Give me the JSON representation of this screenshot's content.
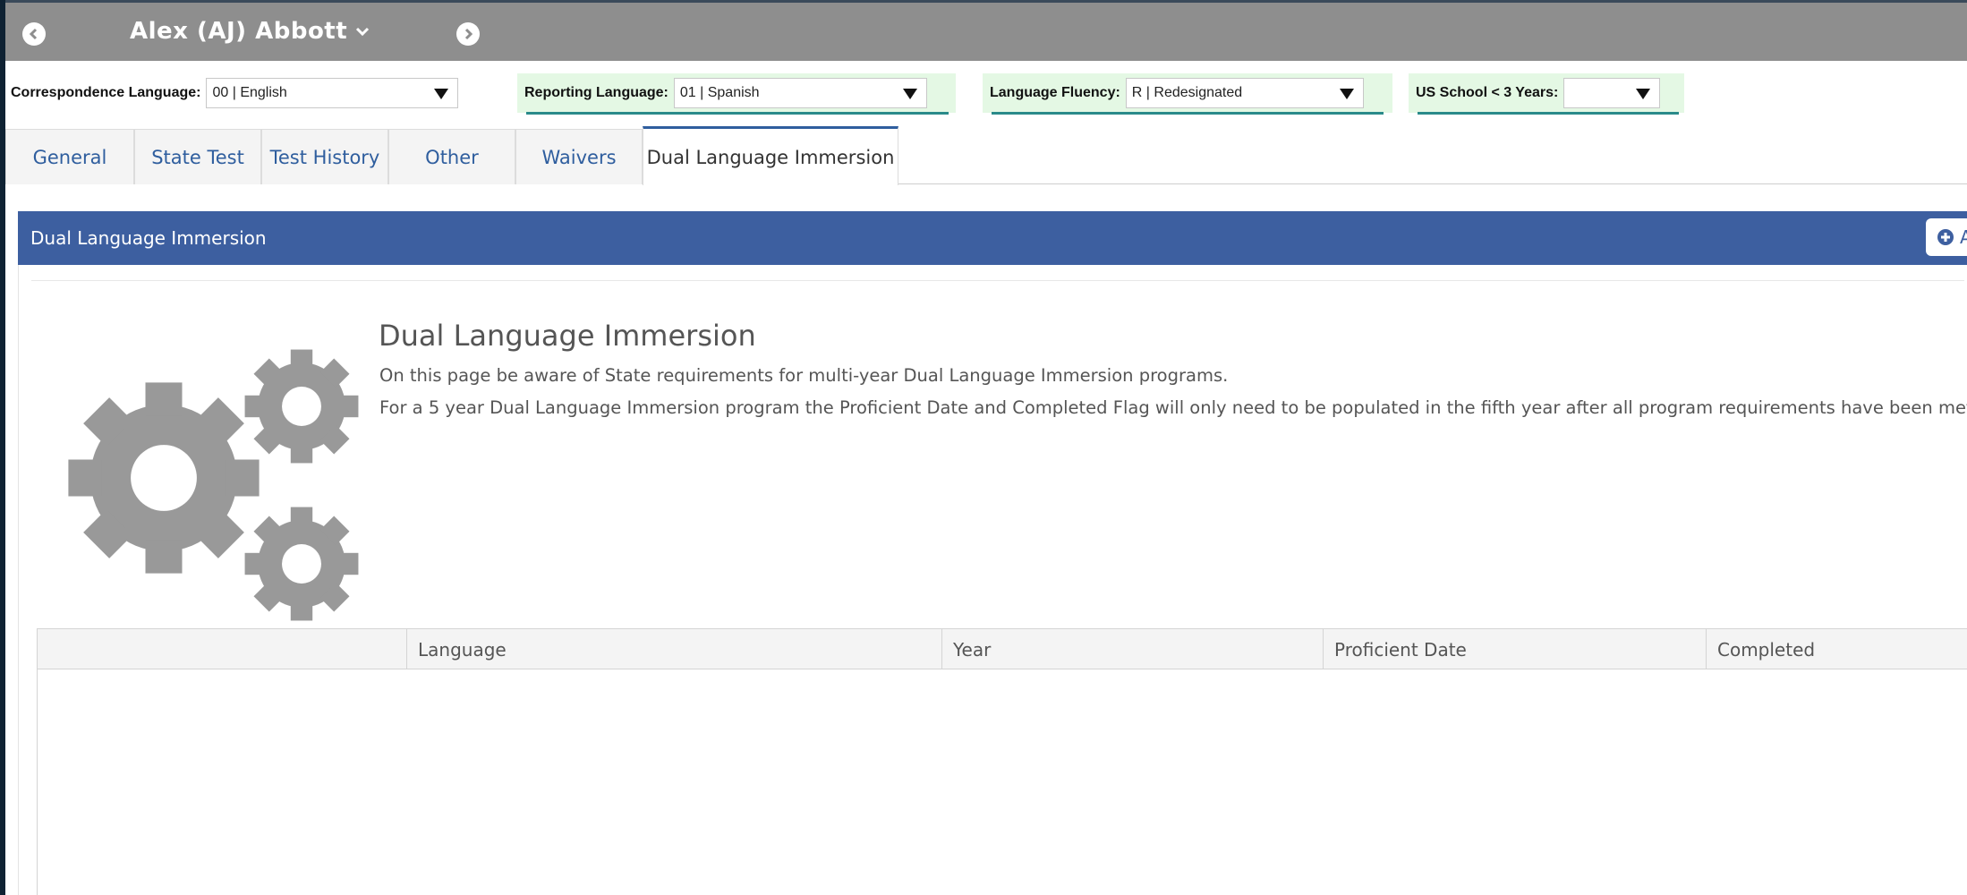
{
  "header": {
    "student_name": "Alex (AJ) Abbott",
    "prev_icon": "arrow-left-circle-icon",
    "next_icon": "arrow-right-circle-icon"
  },
  "fields": {
    "correspondence": {
      "label": "Correspondence Language:",
      "value": "00 | English"
    },
    "reporting": {
      "label": "Reporting Language:",
      "value": "01 | Spanish"
    },
    "fluency": {
      "label": "Language Fluency:",
      "value": "R | Redesignated"
    },
    "us_school": {
      "label": "US School < 3 Years:",
      "value": ""
    }
  },
  "tabs": [
    {
      "label": "General"
    },
    {
      "label": "State Test"
    },
    {
      "label": "Test History"
    },
    {
      "label": "Other"
    },
    {
      "label": "Waivers"
    },
    {
      "label": "Dual Language Immersion",
      "active": true
    }
  ],
  "panel": {
    "title": "Dual Language Immersion",
    "add_label": "Ad",
    "info_title": "Dual Language Immersion",
    "info_line1": "On this page be aware of State requirements for multi-year Dual Language Immersion programs.",
    "info_line2": "For a 5 year Dual Language Immersion program the Proficient Date and Completed Flag will only need to be populated in the fifth year after all program requirements have been met."
  },
  "grid": {
    "columns": [
      "",
      "Language",
      "Year",
      "Proficient Date",
      "Completed"
    ]
  },
  "colors": {
    "header_bar": "#8e8e8e",
    "panel_header": "#3d5fa0",
    "tab_text": "#2f5e9e",
    "field_highlight": "#e4f8e4"
  }
}
